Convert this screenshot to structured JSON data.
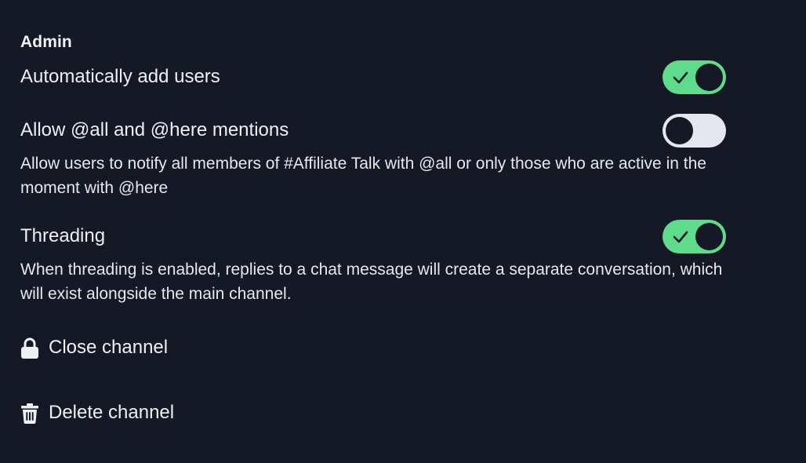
{
  "admin": {
    "title": "Admin",
    "settings": [
      {
        "label": "Automatically add users",
        "enabled": true,
        "description": ""
      },
      {
        "label": "Allow @all and @here mentions",
        "enabled": false,
        "description": "Allow users to notify all members of #Affiliate Talk with @all or only those who are active in the moment with @here"
      },
      {
        "label": "Threading",
        "enabled": true,
        "description": "When threading is enabled, replies to a chat message will create a separate conversation, which will exist alongside the main channel."
      }
    ],
    "actions": [
      {
        "label": "Close channel",
        "icon": "lock-icon"
      },
      {
        "label": "Delete channel",
        "icon": "trash-icon"
      }
    ]
  },
  "colors": {
    "background": "#141925",
    "toggle_on": "#5fdc8b",
    "toggle_off": "#e5e7ee"
  }
}
